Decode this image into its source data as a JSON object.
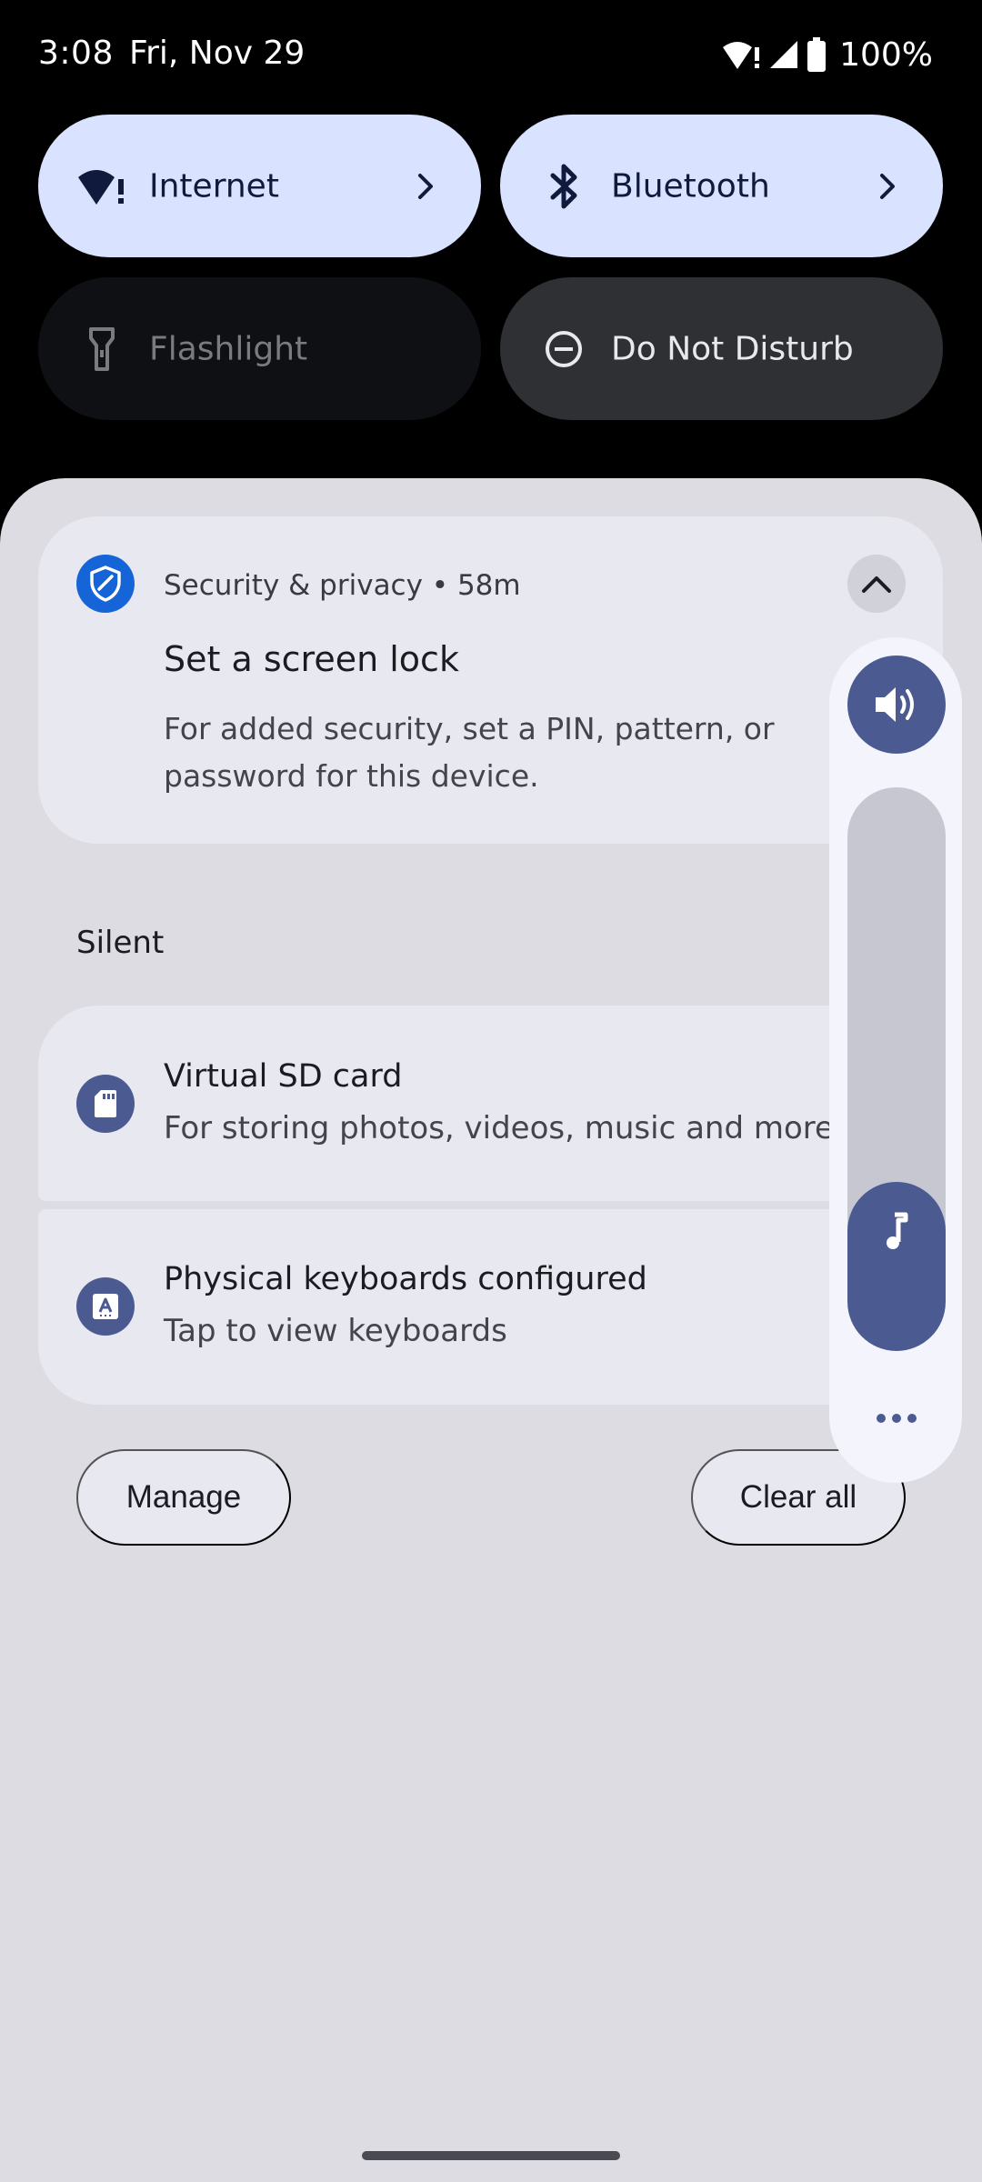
{
  "status_bar": {
    "time": "3:08",
    "date": "Fri, Nov 29",
    "battery": "100%",
    "icons": [
      "wifi-alert-icon",
      "cell-signal-icon",
      "battery-icon"
    ]
  },
  "quick_settings": [
    {
      "label": "Internet",
      "state": "on",
      "icon": "wifi-alert-icon",
      "has_chevron": true
    },
    {
      "label": "Bluetooth",
      "state": "on",
      "icon": "bluetooth-icon",
      "has_chevron": true
    },
    {
      "label": "Flashlight",
      "state": "off",
      "icon": "flashlight-icon",
      "has_chevron": false
    },
    {
      "label": "Do Not Disturb",
      "state": "off",
      "icon": "do-not-disturb-icon",
      "has_chevron": false
    }
  ],
  "notifications": {
    "security": {
      "app": "Security & privacy",
      "time": "58m",
      "header": "Security & privacy • 58m",
      "title": "Set a screen lock",
      "text": "For added security, set a PIN, pattern, or password for this device."
    },
    "silent_section_label": "Silent",
    "silent": [
      {
        "title": "Virtual SD card",
        "text": "For storing photos, videos, music and more",
        "icon": "sd-card-icon"
      },
      {
        "title": "Physical keyboards configured",
        "text": "Tap to view keyboards",
        "icon": "keyboard-icon"
      }
    ],
    "manage_label": "Manage",
    "clear_all_label": "Clear all"
  },
  "volume": {
    "stream_icon": "music-note-icon",
    "ringer_icon": "speaker-icon",
    "level_fraction": 0.3,
    "more_icon": "more-horizontal-icon"
  },
  "colors": {
    "qs_active": "#d9e2ff",
    "accent": "#4b5b92",
    "shade_bg": "#dcdce2",
    "card_bg": "#e8e8f0",
    "security_icon": "#1565d8"
  }
}
